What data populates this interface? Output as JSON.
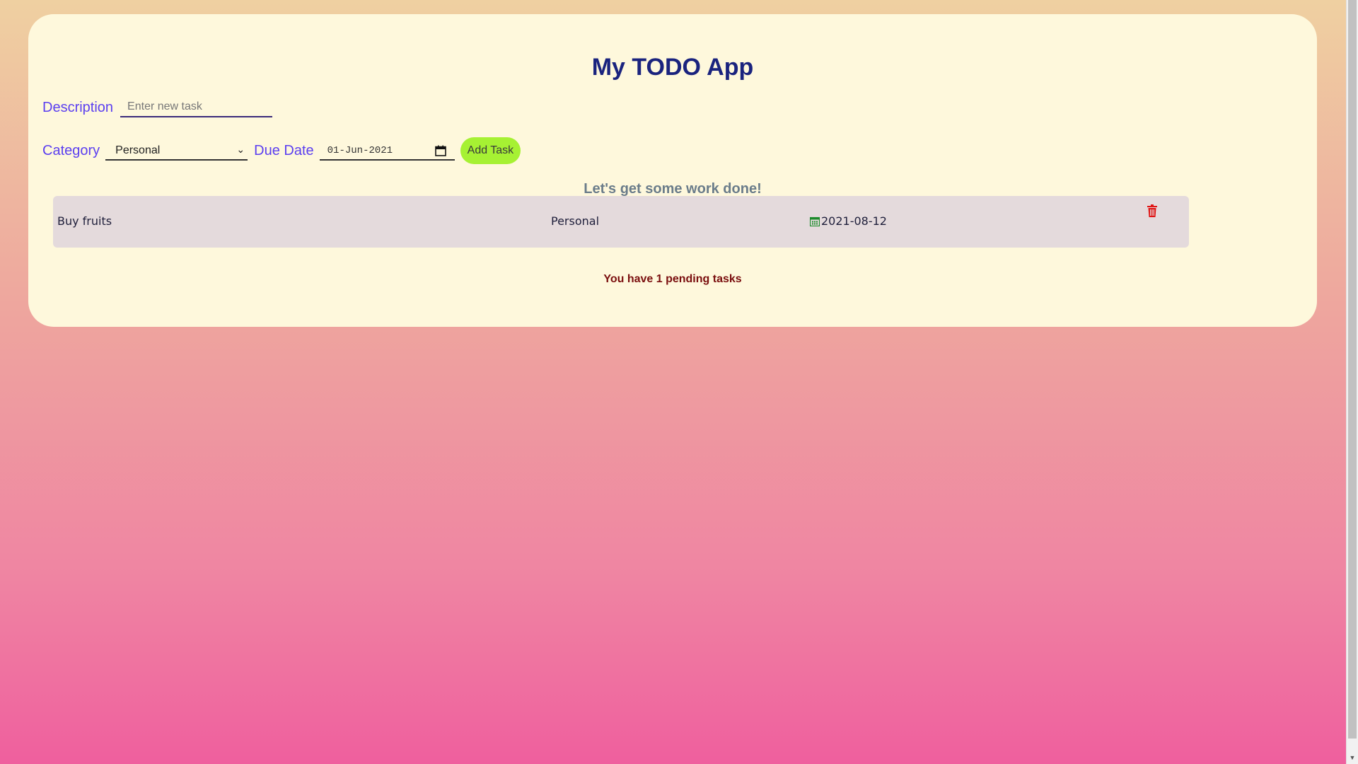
{
  "app": {
    "title": "My TODO App"
  },
  "form": {
    "description_label": "Description",
    "description_placeholder": "Enter new task",
    "description_value": "",
    "category_label": "Category",
    "category_value": "Personal",
    "due_date_label": "Due Date",
    "due_date_value": "01-Jun-2021",
    "add_button_label": "Add Task"
  },
  "motivation": "Let's get some work done!",
  "tasks": [
    {
      "description": "Buy fruits",
      "category": "Personal",
      "due_date": "2021-08-12"
    }
  ],
  "pending_text": "You have 1 pending tasks",
  "icons": {
    "calendar": "calendar-icon",
    "delete": "trash-icon",
    "dropdown": "chevron-down-icon"
  },
  "colors": {
    "title": "#1a237e",
    "label": "#5b3ff0",
    "add_button": "#a6f133",
    "delete_icon": "#e01515",
    "task_calendar_icon": "#1b8a2a",
    "pending_text": "#7a0e0e",
    "card": "#fef8dc",
    "task_row": "#e4dadc"
  }
}
